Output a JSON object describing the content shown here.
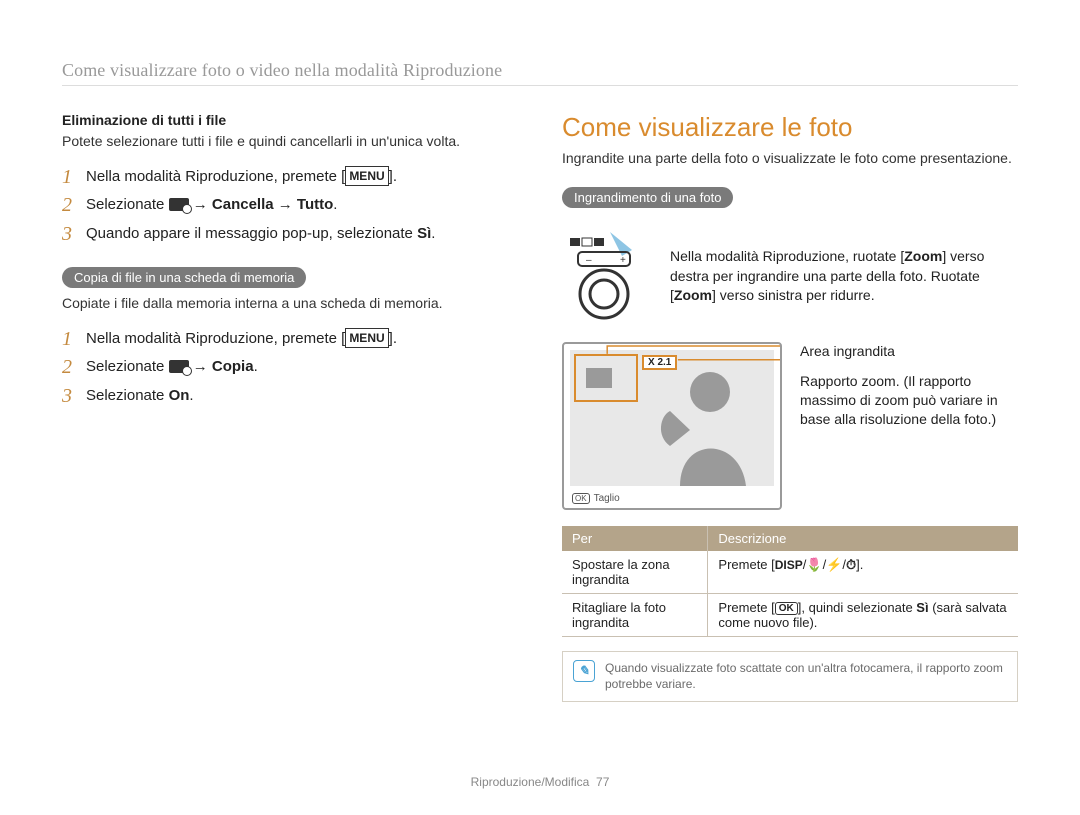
{
  "breadcrumb": "Come visualizzare foto o video nella modalità Riproduzione",
  "left": {
    "delete_all": {
      "heading": "Eliminazione di tutti i file",
      "desc": "Potete selezionare tutti i file e quindi cancellarli in un'unica volta.",
      "steps": [
        {
          "pre": "Nella modalità Riproduzione, premete [",
          "badge": "MENU",
          "post": "]."
        },
        {
          "pre": "Selezionate ",
          "icon": "tool",
          "post": " → Cancella → Tutto",
          "bold_trail": true,
          "trail": "."
        },
        {
          "pre": "Quando appare il messaggio pop-up, selezionate ",
          "bold": "Sì",
          "post": "."
        }
      ]
    },
    "copy": {
      "pill": "Copia di file in una scheda di memoria",
      "desc": "Copiate i file dalla memoria interna a una scheda di memoria.",
      "steps": [
        {
          "pre": "Nella modalità Riproduzione, premete [",
          "badge": "MENU",
          "post": "]."
        },
        {
          "pre": "Selezionate ",
          "icon": "tool",
          "post": " → Copia",
          "bold_trail": true,
          "trail": "."
        },
        {
          "pre": "Selezionate ",
          "bold": "On",
          "post": "."
        }
      ]
    }
  },
  "right": {
    "title": "Come visualizzare le foto",
    "intro": "Ingrandite una parte della foto o visualizzate le foto come presentazione.",
    "zoom_pill": "Ingrandimento di una foto",
    "dial_text": {
      "l1": "Nella modalità Riproduzione, ruotate [",
      "b1": "Zoom",
      "l2": "] verso destra per ingrandire una parte della foto. Ruotate [",
      "b2": "Zoom",
      "l3": "] verso sinistra per ridurre."
    },
    "screen": {
      "area_label": "Area ingrandita",
      "ratio_label": "Rapporto zoom. (Il rapporto massimo di zoom può variare in base alla risoluzione della foto.)",
      "zoom_value": "X 2.1",
      "caption_ok": "OK",
      "caption_text": "Taglio"
    },
    "table": {
      "h1": "Per",
      "h2": "Descrizione",
      "rows": [
        {
          "c1": "Spostare la zona ingrandita",
          "c2_pre": "Premete [",
          "c2_badge": "DISP",
          "c2_mid": "/",
          "c2_post": "]."
        },
        {
          "c1": "Ritagliare la foto ingrandita",
          "c2_pre": "Premete [",
          "c2_ok": "OK",
          "c2_mid": "], quindi selezionate ",
          "c2_bold": "Sì",
          "c2_post": " (sarà salvata come nuovo file)."
        }
      ]
    },
    "note": "Quando visualizzate foto scattate con un'altra fotocamera, il rapporto zoom potrebbe variare."
  },
  "footer": {
    "section": "Riproduzione/Modifica",
    "page": "77"
  }
}
